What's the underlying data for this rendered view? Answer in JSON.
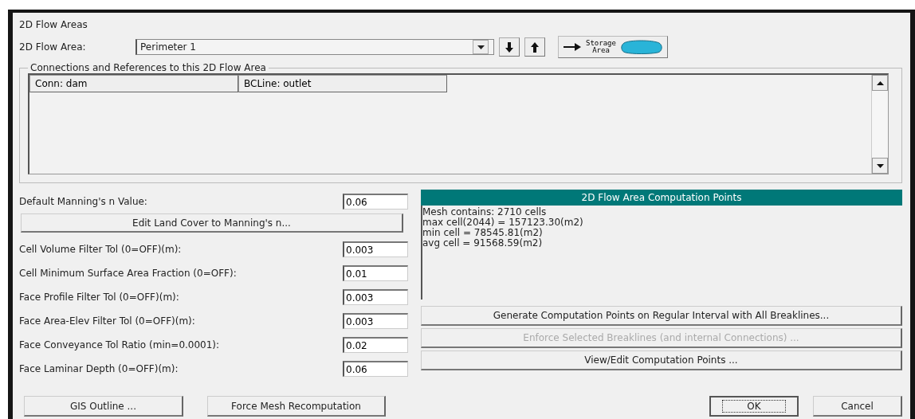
{
  "window": {
    "title": "2D Flow Areas"
  },
  "flow_area": {
    "label": "2D Flow Area:",
    "value": "Perimeter 1",
    "storage_button": {
      "line1": "Storage",
      "line2": "Area"
    }
  },
  "connections": {
    "title": "Connections and References to this 2D Flow Area",
    "items": [
      "Conn: dam",
      "BCLine: outlet"
    ]
  },
  "parameters": [
    {
      "kind": "field",
      "label": "Default Manning's n Value:",
      "value": "0.06"
    },
    {
      "kind": "button",
      "label": "Edit Land Cover to Manning's n..."
    },
    {
      "kind": "field",
      "label": "Cell Volume Filter Tol (0=OFF)(m):",
      "value": "0.003"
    },
    {
      "kind": "field",
      "label": "Cell Minimum Surface Area Fraction (0=OFF):",
      "value": "0.01"
    },
    {
      "kind": "field",
      "label": "Face Profile Filter Tol (0=OFF)(m):",
      "value": "0.003"
    },
    {
      "kind": "field",
      "label": "Face Area-Elev Filter Tol (0=OFF)(m):",
      "value": "0.003"
    },
    {
      "kind": "field",
      "label": "Face Conveyance Tol Ratio (min=0.0001):",
      "value": "0.02"
    },
    {
      "kind": "field",
      "label": "Face Laminar Depth (0=OFF)(m):",
      "value": "0.06"
    }
  ],
  "computation_points": {
    "title": "2D Flow Area Computation Points",
    "lines": [
      "Mesh contains: 2710 cells",
      "max cell(2044) = 157123.30(m2)",
      "min cell =  78545.81(m2)",
      "avg cell =  91568.59(m2)"
    ],
    "buttons": [
      {
        "label": "Generate Computation Points on Regular Interval with All Breaklines...",
        "disabled": false
      },
      {
        "label": "Enforce Selected Breaklines (and internal Connections) ...",
        "disabled": true
      },
      {
        "label": "View/Edit Computation Points ...",
        "disabled": false
      }
    ]
  },
  "bottom_buttons": [
    {
      "label": "GIS Outline ...",
      "focused": false
    },
    {
      "label": "Force Mesh Recomputation",
      "focused": false
    }
  ],
  "dialog_buttons": [
    {
      "label": "OK",
      "focused": true
    },
    {
      "label": "Cancel",
      "focused": false
    }
  ]
}
